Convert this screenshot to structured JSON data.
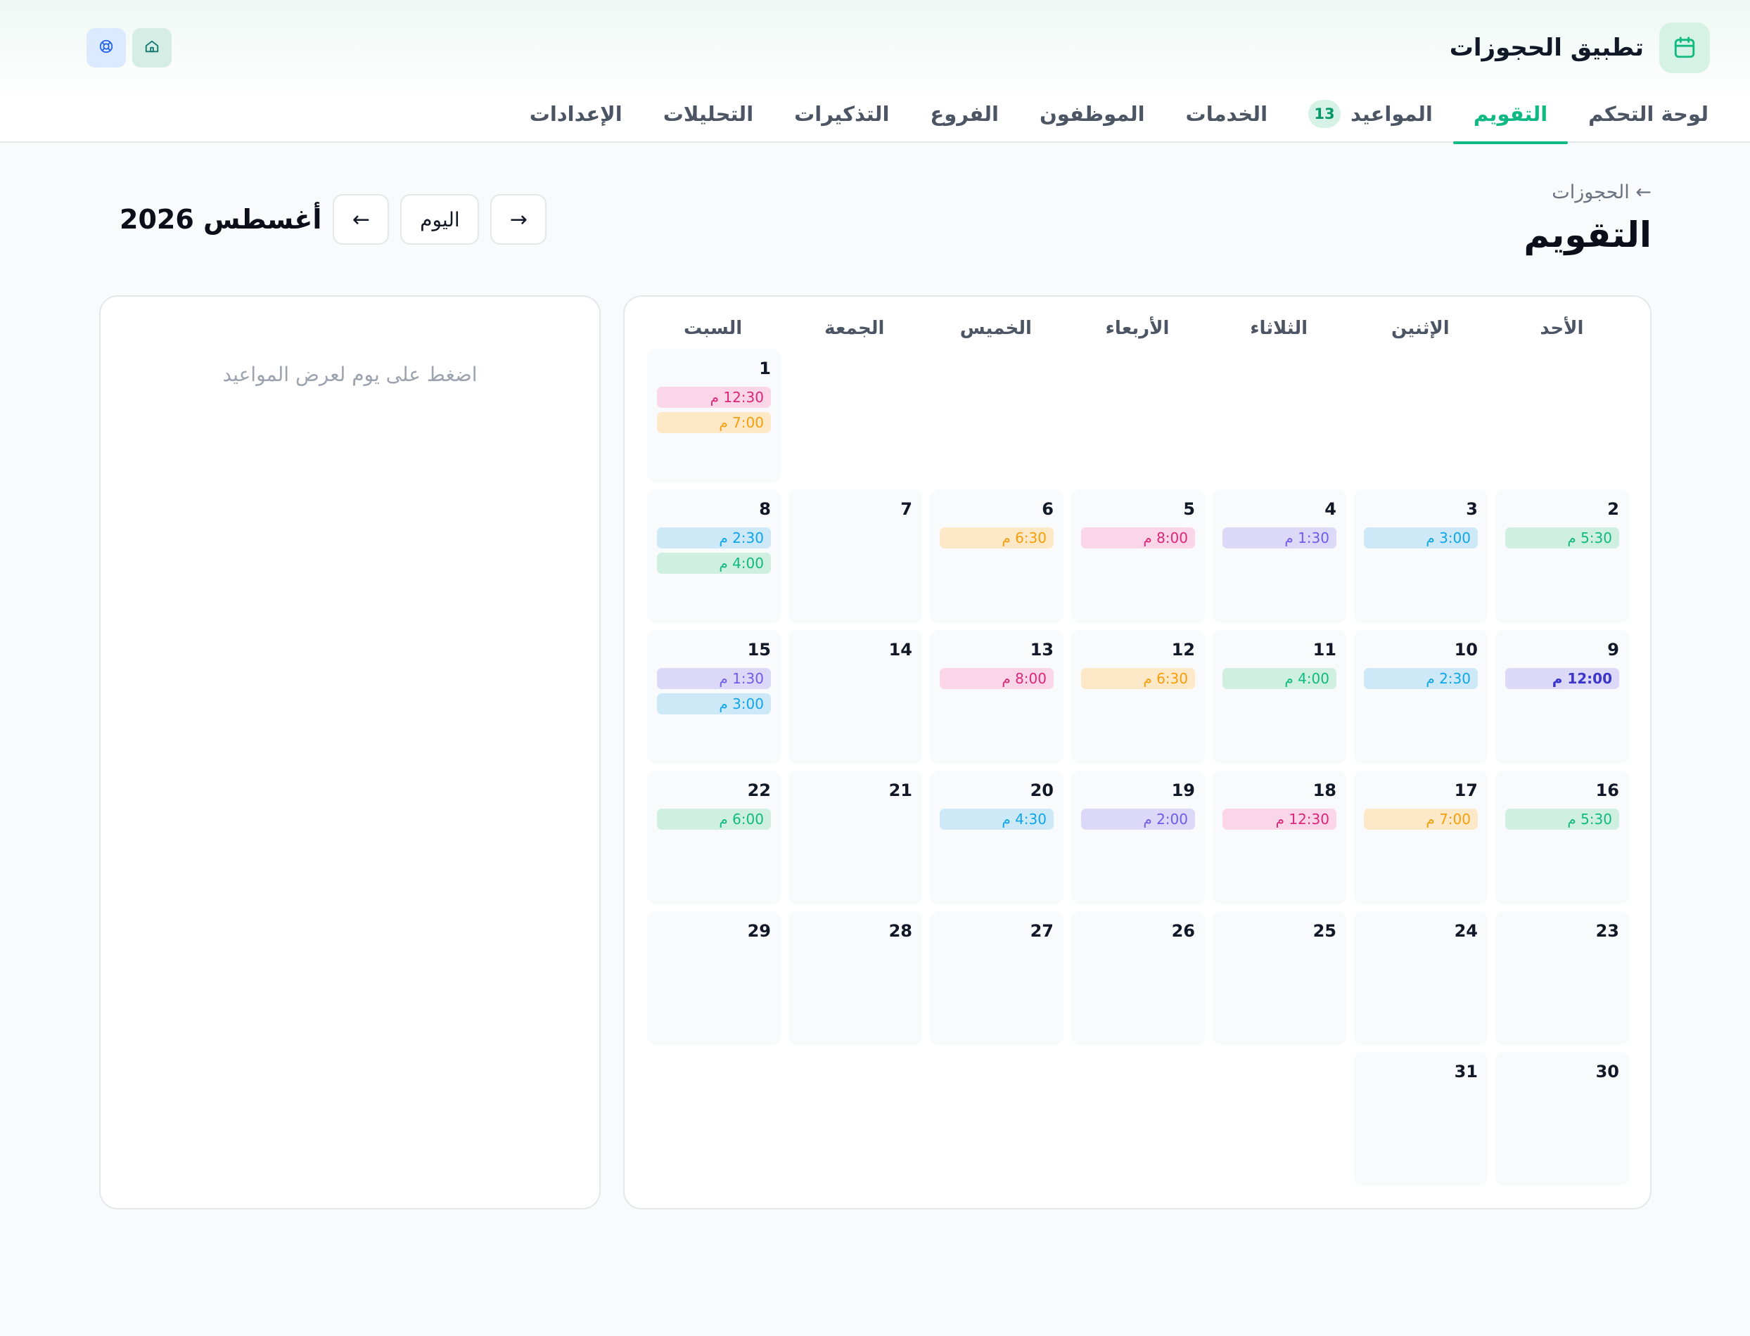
{
  "app": {
    "title": "تطبيق الحجوزات"
  },
  "nav": [
    {
      "label": "لوحة التحكم",
      "active": false
    },
    {
      "label": "التقويم",
      "active": true
    },
    {
      "label": "المواعيد",
      "active": false,
      "badge": "13"
    },
    {
      "label": "الخدمات",
      "active": false
    },
    {
      "label": "الموظفون",
      "active": false
    },
    {
      "label": "الفروع",
      "active": false
    },
    {
      "label": "التذكيرات",
      "active": false
    },
    {
      "label": "التحليلات",
      "active": false
    },
    {
      "label": "الإعدادات",
      "active": false
    }
  ],
  "page": {
    "breadcrumb": "← الحجوزات",
    "title": "التقويم"
  },
  "month_nav": {
    "month_label": "أغسطس 2026",
    "prev_label": "←",
    "today_label": "اليوم",
    "next_label": "→"
  },
  "calendar": {
    "weekdays": [
      "الأحد",
      "الإثنين",
      "الثلاثاء",
      "الأربعاء",
      "الخميس",
      "الجمعة",
      "السبت"
    ],
    "leading_blanks": 6,
    "days": [
      {
        "n": "1",
        "appts": [
          {
            "t": "12:30 م",
            "c": "pink"
          },
          {
            "t": "7:00 م",
            "c": "orange"
          }
        ]
      },
      {
        "n": "2",
        "appts": [
          {
            "t": "5:30 م",
            "c": "green"
          }
        ]
      },
      {
        "n": "3",
        "appts": [
          {
            "t": "3:00 م",
            "c": "blue"
          }
        ]
      },
      {
        "n": "4",
        "appts": [
          {
            "t": "1:30 م",
            "c": "purple"
          }
        ]
      },
      {
        "n": "5",
        "appts": [
          {
            "t": "8:00 م",
            "c": "pink"
          }
        ]
      },
      {
        "n": "6",
        "appts": [
          {
            "t": "6:30 م",
            "c": "orange"
          }
        ]
      },
      {
        "n": "7",
        "appts": []
      },
      {
        "n": "8",
        "appts": [
          {
            "t": "2:30 م",
            "c": "blue"
          },
          {
            "t": "4:00 م",
            "c": "green"
          }
        ]
      },
      {
        "n": "9",
        "appts": [
          {
            "t": "12:00 م",
            "c": "purple bold"
          }
        ]
      },
      {
        "n": "10",
        "appts": [
          {
            "t": "2:30 م",
            "c": "blue"
          }
        ]
      },
      {
        "n": "11",
        "appts": [
          {
            "t": "4:00 م",
            "c": "green"
          }
        ]
      },
      {
        "n": "12",
        "appts": [
          {
            "t": "6:30 م",
            "c": "orange"
          }
        ]
      },
      {
        "n": "13",
        "appts": [
          {
            "t": "8:00 م",
            "c": "pink"
          }
        ]
      },
      {
        "n": "14",
        "appts": []
      },
      {
        "n": "15",
        "appts": [
          {
            "t": "1:30 م",
            "c": "purple"
          },
          {
            "t": "3:00 م",
            "c": "blue"
          }
        ]
      },
      {
        "n": "16",
        "appts": [
          {
            "t": "5:30 م",
            "c": "green"
          }
        ]
      },
      {
        "n": "17",
        "appts": [
          {
            "t": "7:00 م",
            "c": "orange"
          }
        ]
      },
      {
        "n": "18",
        "appts": [
          {
            "t": "12:30 م",
            "c": "pink"
          }
        ]
      },
      {
        "n": "19",
        "appts": [
          {
            "t": "2:00 م",
            "c": "purple"
          }
        ]
      },
      {
        "n": "20",
        "appts": [
          {
            "t": "4:30 م",
            "c": "blue"
          }
        ]
      },
      {
        "n": "21",
        "appts": []
      },
      {
        "n": "22",
        "appts": [
          {
            "t": "6:00 م",
            "c": "green"
          }
        ]
      },
      {
        "n": "23",
        "appts": []
      },
      {
        "n": "24",
        "appts": []
      },
      {
        "n": "25",
        "appts": []
      },
      {
        "n": "26",
        "appts": []
      },
      {
        "n": "27",
        "appts": []
      },
      {
        "n": "28",
        "appts": []
      },
      {
        "n": "29",
        "appts": []
      },
      {
        "n": "30",
        "appts": []
      },
      {
        "n": "31",
        "appts": []
      }
    ]
  },
  "side_panel": {
    "hint": "اضغط على يوم لعرض المواعيد"
  },
  "header_actions": [
    {
      "icon": "home-icon"
    },
    {
      "icon": "support-icon"
    }
  ],
  "colors": {
    "accent": "#10b981",
    "pink": "#db2777",
    "orange": "#f59e0b",
    "blue": "#0ea5e9",
    "green": "#10b981",
    "purple": "#6d5ce8"
  }
}
